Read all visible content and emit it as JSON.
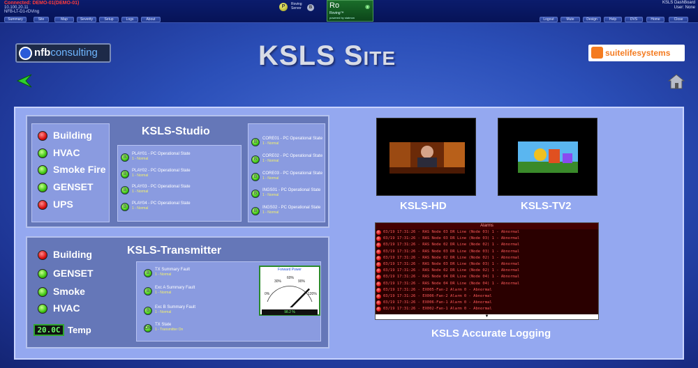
{
  "topbar": {
    "connection": "Connected: DEMO-01(DEMO-01)",
    "ip": "10.100.20.11",
    "host": "NFB-LT-D1-rDVing",
    "nav_left": [
      "Summary",
      "Site",
      "Map",
      "Severity",
      "Setup",
      "Logs",
      "About"
    ],
    "server_label_1": "Roving",
    "server_label_2": "Server",
    "server_b": "B",
    "roving_title": "Ro",
    "roving_sub": "Roving™",
    "roving_tiny": "powered by statmon",
    "dashboard_title": "KSLS DashBoard",
    "user": "User: None",
    "nav_right": [
      "Logout",
      "Mute",
      "Design",
      "Help",
      "DVS",
      "Home",
      "Close"
    ]
  },
  "header": {
    "logo_left_a": "nfb",
    "logo_left_b": "consulting",
    "title": "KSLS Site",
    "logo_right": "suitelifesystems"
  },
  "studio": {
    "title": "KSLS-Studio",
    "status": [
      {
        "label": "Building",
        "state": "red"
      },
      {
        "label": "HVAC",
        "state": "green"
      },
      {
        "label": "Smoke Fire",
        "state": "green"
      },
      {
        "label": "GENSET",
        "state": "green"
      },
      {
        "label": "UPS",
        "state": "red"
      }
    ],
    "plays": [
      {
        "name": "PLAY01 - PC Operational State",
        "state": "1 - Normal"
      },
      {
        "name": "PLAY02 - PC Operational State",
        "state": "1 - Normal"
      },
      {
        "name": "PLAY03 - PC Operational State",
        "state": "1 - Normal"
      },
      {
        "name": "PLAY04 - PC Operational State",
        "state": "1 - Normal"
      }
    ],
    "cores": [
      {
        "name": "CORE01 - PC Operational State",
        "state": "1 - Normal"
      },
      {
        "name": "CORE02 - PC Operational State",
        "state": "1 - Normal"
      },
      {
        "name": "CORE03 - PC Operational State",
        "state": "1 - Normal"
      },
      {
        "name": "INGS01 - PC Operational State",
        "state": "1 - Normal"
      },
      {
        "name": "INGS02 - PC Operational State",
        "state": "1 - Normal"
      }
    ]
  },
  "transmitter": {
    "title": "KSLS-Transmitter",
    "status": [
      {
        "label": "Building",
        "state": "red"
      },
      {
        "label": "GENSET",
        "state": "green"
      },
      {
        "label": "Smoke",
        "state": "green"
      },
      {
        "label": "HVAC",
        "state": "green"
      }
    ],
    "temp_value": "20.0C",
    "temp_label": "Temp",
    "faults": [
      {
        "name": "TX Summary Fault",
        "state": "1 - Normal"
      },
      {
        "name": "Exc A Summary Fault",
        "state": "1 - Normal"
      },
      {
        "name": "Exc B Summary Fault",
        "state": "1 - Normal"
      },
      {
        "name": "TX State",
        "state": "1 - Transmitter On"
      }
    ],
    "gauge": {
      "title": "Forward Power",
      "ticks": [
        "0%",
        "30%",
        "60%",
        "90%",
        "120%"
      ],
      "value_percent": 98.2,
      "reading": "98.2 %"
    }
  },
  "videos": [
    {
      "label": "KSLS-HD"
    },
    {
      "label": "KSLS-TV2"
    }
  ],
  "log": {
    "header": "Alarms",
    "label": "KSLS Accurate Logging",
    "rows": [
      "03/19 17:31:26 - RAS Node 03 DR Line (Node 03) 1 - Abnormal",
      "03/19 17:31:26 - RAS Node 03 DR Line (Node 03) 1 - Abnormal",
      "03/19 17:31:26 - RAS Node 02 DR Line (Node 02) 1 - Abnormal",
      "03/19 17:31:26 - RAS Node 03 DR Line (Node 03) 1 - Abnormal",
      "03/19 17:31:26 - RAS Node 02 DR Line (Node 02) 1 - Abnormal",
      "03/19 17:31:26 - RAS Node 03 DR Line (Node 03) 1 - Abnormal",
      "03/19 17:31:26 - RAS Node 02 DR Line (Node 02) 1 - Abnormal",
      "03/19 17:31:26 - RAS Node 04 DR Line (Node 04) 1 - Abnormal",
      "03/19 17:31:26 - RAS Node 04 DR Line (Node 04) 1 - Abnormal",
      "03/19 17:31:26 - EX005-Fan-2 Alarm 0 - Abnormal",
      "03/19 17:31:26 - EX006-Fan-2 Alarm 0 - Abnormal",
      "03/19 17:31:26 - EX006-Fan-1 Alarm 0 - Abnormal",
      "03/19 17:31:26 - EX002-Fan-1 Alarm 0 - Abnormal"
    ]
  }
}
